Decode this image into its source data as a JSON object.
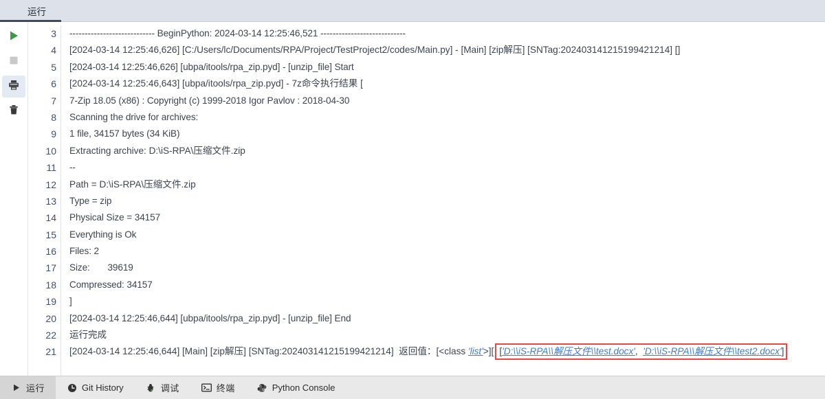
{
  "window": {
    "tabs": [
      {
        "label": "运行",
        "active": true
      }
    ]
  },
  "toolbar": {
    "buttons": [
      {
        "name": "run-button",
        "icon": "play-icon",
        "selected": false
      },
      {
        "name": "stop-button",
        "icon": "stop-square-icon",
        "selected": false
      },
      {
        "name": "print-button",
        "icon": "printer-icon",
        "selected": true
      },
      {
        "name": "clear-button",
        "icon": "trash-icon",
        "selected": false
      }
    ]
  },
  "log": {
    "lines": [
      {
        "num": "3",
        "text": "---------------------------- BeginPython: 2024-03-14 12:25:46,521 ----------------------------"
      },
      {
        "num": "4",
        "text": "[2024-03-14 12:25:46,626] [C:/Users/lc/Documents/RPA/Project/TestProject2/codes/Main.py] - [Main] [zip解压] [SNTag:202403141215199421214] []"
      },
      {
        "num": "5",
        "text": "[2024-03-14 12:25:46,626] [ubpa/itools/rpa_zip.pyd] - [unzip_file] Start"
      },
      {
        "num": "6",
        "text": "[2024-03-14 12:25:46,643] [ubpa/itools/rpa_zip.pyd] - 7z命令执行结果 ["
      },
      {
        "num": "7",
        "text": "7-Zip 18.05 (x86) : Copyright (c) 1999-2018 Igor Pavlov : 2018-04-30"
      },
      {
        "num": "8",
        "text": "Scanning the drive for archives:"
      },
      {
        "num": "9",
        "text": "1 file, 34157 bytes (34 KiB)"
      },
      {
        "num": "10",
        "text": "Extracting archive: D:\\iS-RPA\\压缩文件.zip"
      },
      {
        "num": "11",
        "text": "--"
      },
      {
        "num": "12",
        "text": "Path = D:\\iS-RPA\\压缩文件.zip"
      },
      {
        "num": "13",
        "text": "Type = zip"
      },
      {
        "num": "14",
        "text": "Physical Size = 34157"
      },
      {
        "num": "15",
        "text": "Everything is Ok"
      },
      {
        "num": "16",
        "text": "Files: 2"
      },
      {
        "num": "17",
        "text": "Size:       39619"
      },
      {
        "num": "18",
        "text": "Compressed: 34157"
      },
      {
        "num": "19",
        "text": "]"
      },
      {
        "num": "20",
        "text": "[2024-03-14 12:25:46,644] [ubpa/itools/rpa_zip.pyd] - [unzip_file] End"
      },
      {
        "num": "22",
        "text": "运行完成"
      }
    ],
    "highlighted_line": {
      "num": "21",
      "prefix": "[2024-03-14 12:25:46,644] [Main] [zip解压] [SNTag:202403141215199421214]  返回值：[<class ",
      "class_link": "'list'",
      "middle": ">][",
      "boxed_prefix": "[",
      "boxed_path_1": "'D:\\\\iS-RPA\\\\解压文件\\\\test.docx'",
      "boxed_sep": ",  ",
      "boxed_path_2": "'D:\\\\iS-RPA\\\\解压文件\\\\test2.docx'",
      "boxed_suffix": "]",
      "box_color": "#ef4444",
      "link_color": "#3b7dd8"
    }
  },
  "statusbar": {
    "items": [
      {
        "label": "运行",
        "icon": "play-triangle-icon",
        "active": true
      },
      {
        "label": "Git History",
        "icon": "clock-icon",
        "active": false
      },
      {
        "label": "调试",
        "icon": "bug-icon",
        "active": false
      },
      {
        "label": "终端",
        "icon": "terminal-icon",
        "active": false
      },
      {
        "label": "Python Console",
        "icon": "python-icon",
        "active": false
      }
    ]
  }
}
